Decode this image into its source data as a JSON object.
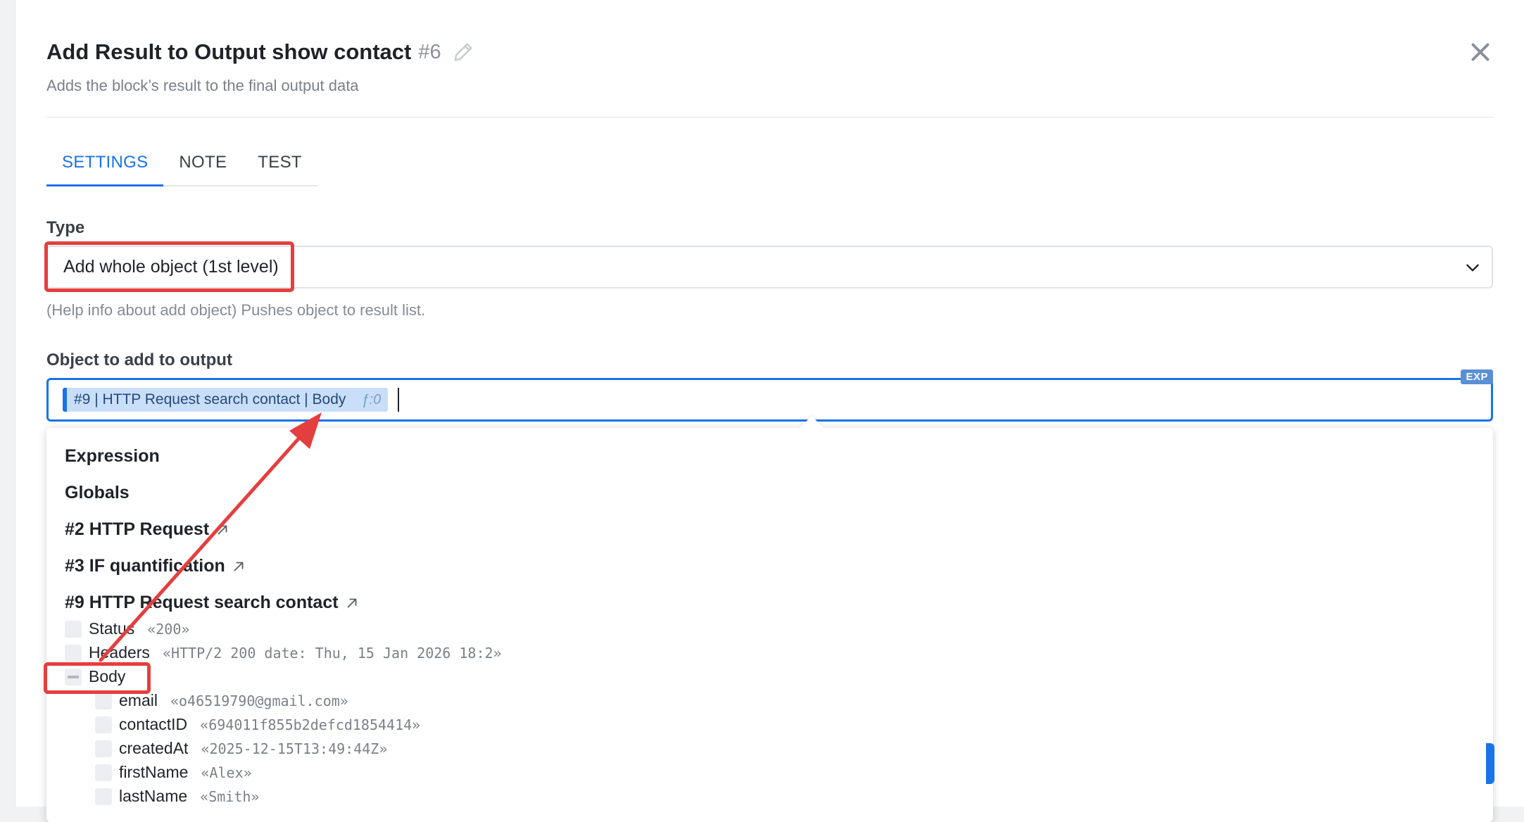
{
  "header": {
    "title": "Add Result to Output show contact",
    "block_number": "#6",
    "subtitle": "Adds the block’s result to the final output data"
  },
  "tabs": [
    {
      "label": "SETTINGS",
      "active": true
    },
    {
      "label": "NOTE",
      "active": false
    },
    {
      "label": "TEST",
      "active": false
    }
  ],
  "type_field": {
    "label": "Type",
    "value": "Add whole object (1st level)",
    "help": "(Help info about add object) Pushes object to result list."
  },
  "object_field": {
    "label": "Object to add to output",
    "chip_text": "#9 | HTTP Request search contact | Body",
    "chip_fx": "ƒ:0",
    "badge": "EXP"
  },
  "dropdown": {
    "sections": [
      {
        "label": "Expression",
        "external": false
      },
      {
        "label": "Globals",
        "external": false
      },
      {
        "label": "#2 HTTP Request",
        "external": true
      },
      {
        "label": "#3 IF quantification",
        "external": true
      },
      {
        "label": "#9 HTTP Request search contact",
        "external": true
      }
    ],
    "tree": [
      {
        "key": "Status",
        "value": "«200»",
        "level": 0,
        "state": "empty"
      },
      {
        "key": "Headers",
        "value": "«HTTP/2 200 date: Thu, 15 Jan 2026 18:2»",
        "level": 0,
        "state": "empty"
      },
      {
        "key": "Body",
        "value": "",
        "level": 0,
        "state": "minus"
      },
      {
        "key": "email",
        "value": "«o46519790@gmail.com»",
        "level": 1,
        "state": "empty"
      },
      {
        "key": "contactID",
        "value": "«694011f855b2defcd1854414»",
        "level": 1,
        "state": "empty"
      },
      {
        "key": "createdAt",
        "value": "«2025-12-15T13:49:44Z»",
        "level": 1,
        "state": "empty"
      },
      {
        "key": "firstName",
        "value": "«Alex»",
        "level": 1,
        "state": "empty"
      },
      {
        "key": "lastName",
        "value": "«Smith»",
        "level": 1,
        "state": "empty"
      }
    ]
  },
  "colors": {
    "accent": "#1a73e8",
    "annotation": "#e53e3e"
  }
}
